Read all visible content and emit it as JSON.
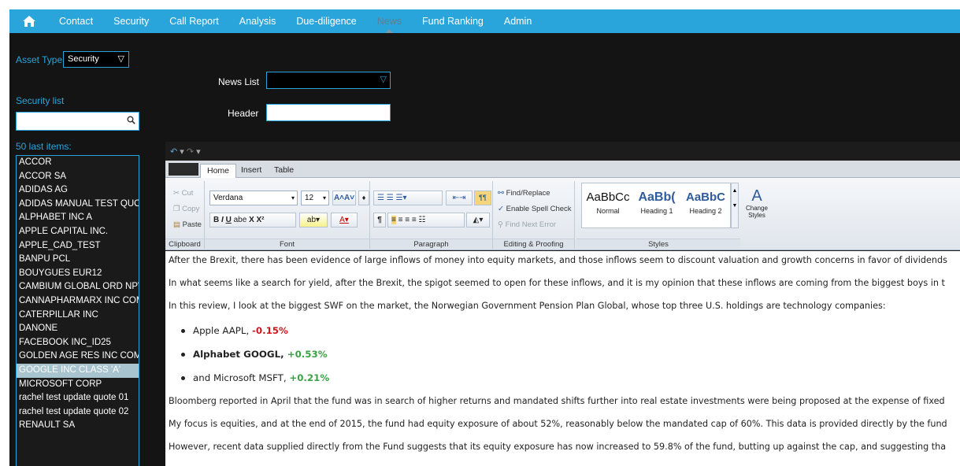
{
  "nav": {
    "home_icon": "home-icon",
    "items": [
      "Contact",
      "Security",
      "Call Report",
      "Analysis",
      "Due-diligence",
      "News",
      "Fund Ranking",
      "Admin"
    ],
    "active": "News"
  },
  "sidebar": {
    "asset_type_label": "Asset Type:",
    "asset_type_value": "Security",
    "security_list_label": "Security list",
    "search_icon": "search-icon",
    "last_items_label": "50 last items:",
    "items": [
      "ACCOR",
      "ACCOR SA",
      "ADIDAS AG",
      "ADIDAS MANUAL TEST QUOTE",
      "ALPHABET INC A",
      "APPLE CAPITAL INC.",
      "APPLE_CAD_TEST",
      "BANPU PCL",
      "BOUYGUES EUR12",
      "CAMBIUM GLOBAL ORD NPV",
      "CANNAPHARMARX INC COM STK",
      "CATERPILLAR INC",
      "DANONE",
      "FACEBOOK INC_ID25",
      "GOLDEN AGE RES INC COM USD",
      "GOOGLE INC CLASS 'A'",
      "MICROSOFT CORP",
      "rachel test update quote 01",
      "rachel test update quote 02",
      "RENAULT SA"
    ],
    "selected": "GOOGLE INC CLASS 'A'"
  },
  "form": {
    "news_list_label": "News List",
    "header_label": "Header"
  },
  "ribbon": {
    "tabs": [
      "Home",
      "Insert",
      "Table"
    ],
    "active_tab": "Home",
    "clipboard": {
      "cut": "Cut",
      "copy": "Copy",
      "paste": "Paste",
      "title": "Clipboard"
    },
    "font": {
      "family": "Verdana",
      "size": "12",
      "title": "Font"
    },
    "paragraph": {
      "title": "Paragraph"
    },
    "editing": {
      "find_replace": "Find/Replace",
      "spell_check": "Enable Spell Check",
      "find_next": "Find Next Error",
      "title": "Editing & Proofing"
    },
    "styles": {
      "items": [
        {
          "sample": "AaBbCc",
          "name": "Normal"
        },
        {
          "sample": "AaBb(",
          "name": "Heading 1"
        },
        {
          "sample": "AaBbC",
          "name": "Heading 2"
        }
      ],
      "change_label": "Change Styles",
      "title": "Styles"
    }
  },
  "document": {
    "paragraphs": [
      "After the Brexit, there has been evidence of large inflows of money into equity markets, and those inflows seem to discount valuation and growth concerns in favor of dividends",
      "In what seems like a search for yield, after the Brexit, the spigot seemed to open for these inflows, and it is my opinion that these inflows are coming from the biggest boys in t",
      "In this review, I look at the biggest SWF on the market, the Norwegian Government Pension Plan Global, whose top three U.S. holdings are technology companies:"
    ],
    "bullets": [
      {
        "text": "Apple AAPL, ",
        "change": "-0.15%",
        "direction": "neg",
        "bold": false
      },
      {
        "text": "Alphabet GOOGL, ",
        "change": "+0.53%",
        "direction": "pos",
        "bold": true
      },
      {
        "text": "and Microsoft MSFT, ",
        "change": "+0.21%",
        "direction": "pos",
        "bold": false
      }
    ],
    "paragraphs_after": [
      "Bloomberg reported in April that the fund was in search of higher returns and mandated shifts further into real estate investments were being proposed at the expense of fixed",
      "My focus is equities, and at the end of 2015, the fund had equity exposure of about 52%, reasonably below the mandated cap of 60%. This data is provided directly by the fund",
      "However, recent data supplied directly from the Fund suggests that its equity exposure has now increased to 59.8% of the fund, butting up against the cap, and suggesting tha"
    ]
  },
  "colors": {
    "accent": "#2aa5dc",
    "background": "#141414",
    "negative": "#d2161e",
    "positive": "#3aa144"
  }
}
